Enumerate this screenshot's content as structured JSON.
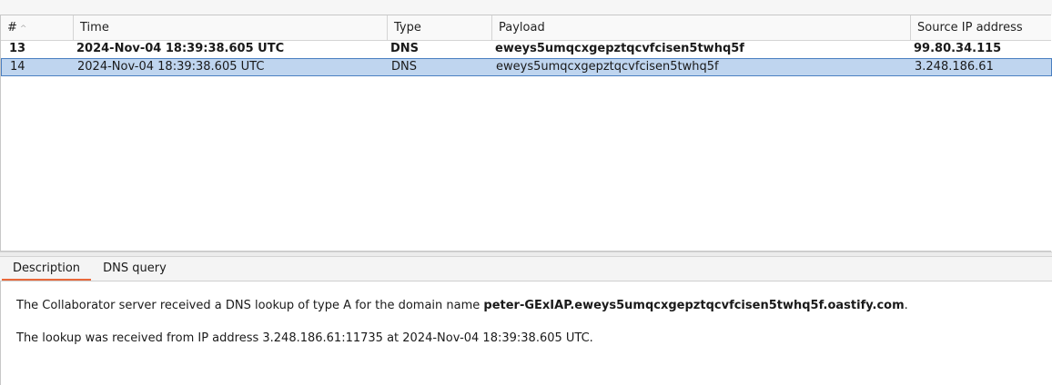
{
  "table": {
    "columns": {
      "num": "#",
      "time": "Time",
      "type": "Type",
      "payload": "Payload",
      "source_ip": "Source IP address"
    },
    "rows": [
      {
        "num": "13",
        "time": "2024-Nov-04 18:39:38.605 UTC",
        "type": "DNS",
        "payload": "eweys5umqcxgepztqcvfcisen5twhq5f",
        "source_ip": "99.80.34.115"
      },
      {
        "num": "14",
        "time": "2024-Nov-04 18:39:38.605 UTC",
        "type": "DNS",
        "payload": "eweys5umqcxgepztqcvfcisen5twhq5f",
        "source_ip": "3.248.186.61"
      }
    ]
  },
  "tabs": {
    "description": "Description",
    "dns_query": "DNS query"
  },
  "description": {
    "line1_prefix": "The Collaborator server received a DNS lookup of type A for the domain name ",
    "line1_domain": "peter-GExIAP.eweys5umqcxgepztqcvfcisen5twhq5f.oastify.com",
    "line1_suffix": ".",
    "line2": "The lookup was received from IP address 3.248.186.61:11735 at 2024-Nov-04 18:39:38.605 UTC."
  },
  "colors": {
    "selected_row": "#bfd5ef",
    "selected_border": "#4a7fc1",
    "active_tab_underline": "#e8683a"
  }
}
